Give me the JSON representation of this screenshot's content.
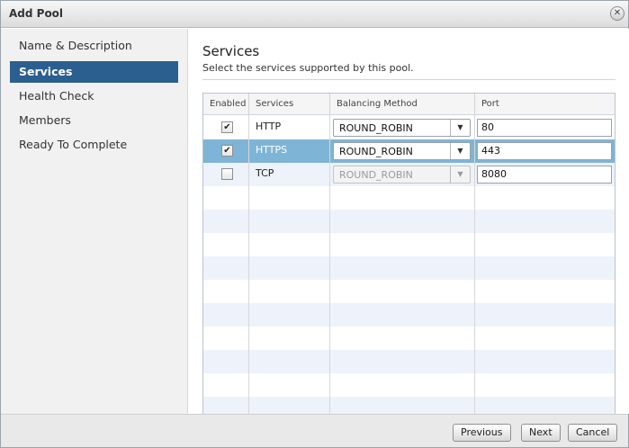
{
  "window": {
    "title": "Add Pool",
    "close_icon": "close-icon"
  },
  "sidebar": {
    "items": [
      {
        "label": "Name & Description",
        "active": false
      },
      {
        "label": "Services",
        "active": true
      },
      {
        "label": "Health Check",
        "active": false
      },
      {
        "label": "Members",
        "active": false
      },
      {
        "label": "Ready To Complete",
        "active": false
      }
    ]
  },
  "main": {
    "heading": "Services",
    "subheading": "Select the services supported by this pool."
  },
  "table": {
    "headers": [
      "Enabled",
      "Services",
      "Balancing Method",
      "Port"
    ],
    "rows": [
      {
        "enabled": true,
        "service": "HTTP",
        "method": "ROUND_ROBIN",
        "port": "80"
      },
      {
        "enabled": true,
        "service": "HTTPS",
        "method": "ROUND_ROBIN",
        "port": "443"
      },
      {
        "enabled": false,
        "service": "TCP",
        "method": "ROUND_ROBIN",
        "port": "8080"
      }
    ]
  },
  "footer": {
    "previous_label": "Previous",
    "next_label": "Next",
    "cancel_label": "Cancel"
  },
  "colors": {
    "active_step": "#2b5f8f",
    "selected_row": "#7eb5d6",
    "alt_row": "#edf2fb"
  }
}
